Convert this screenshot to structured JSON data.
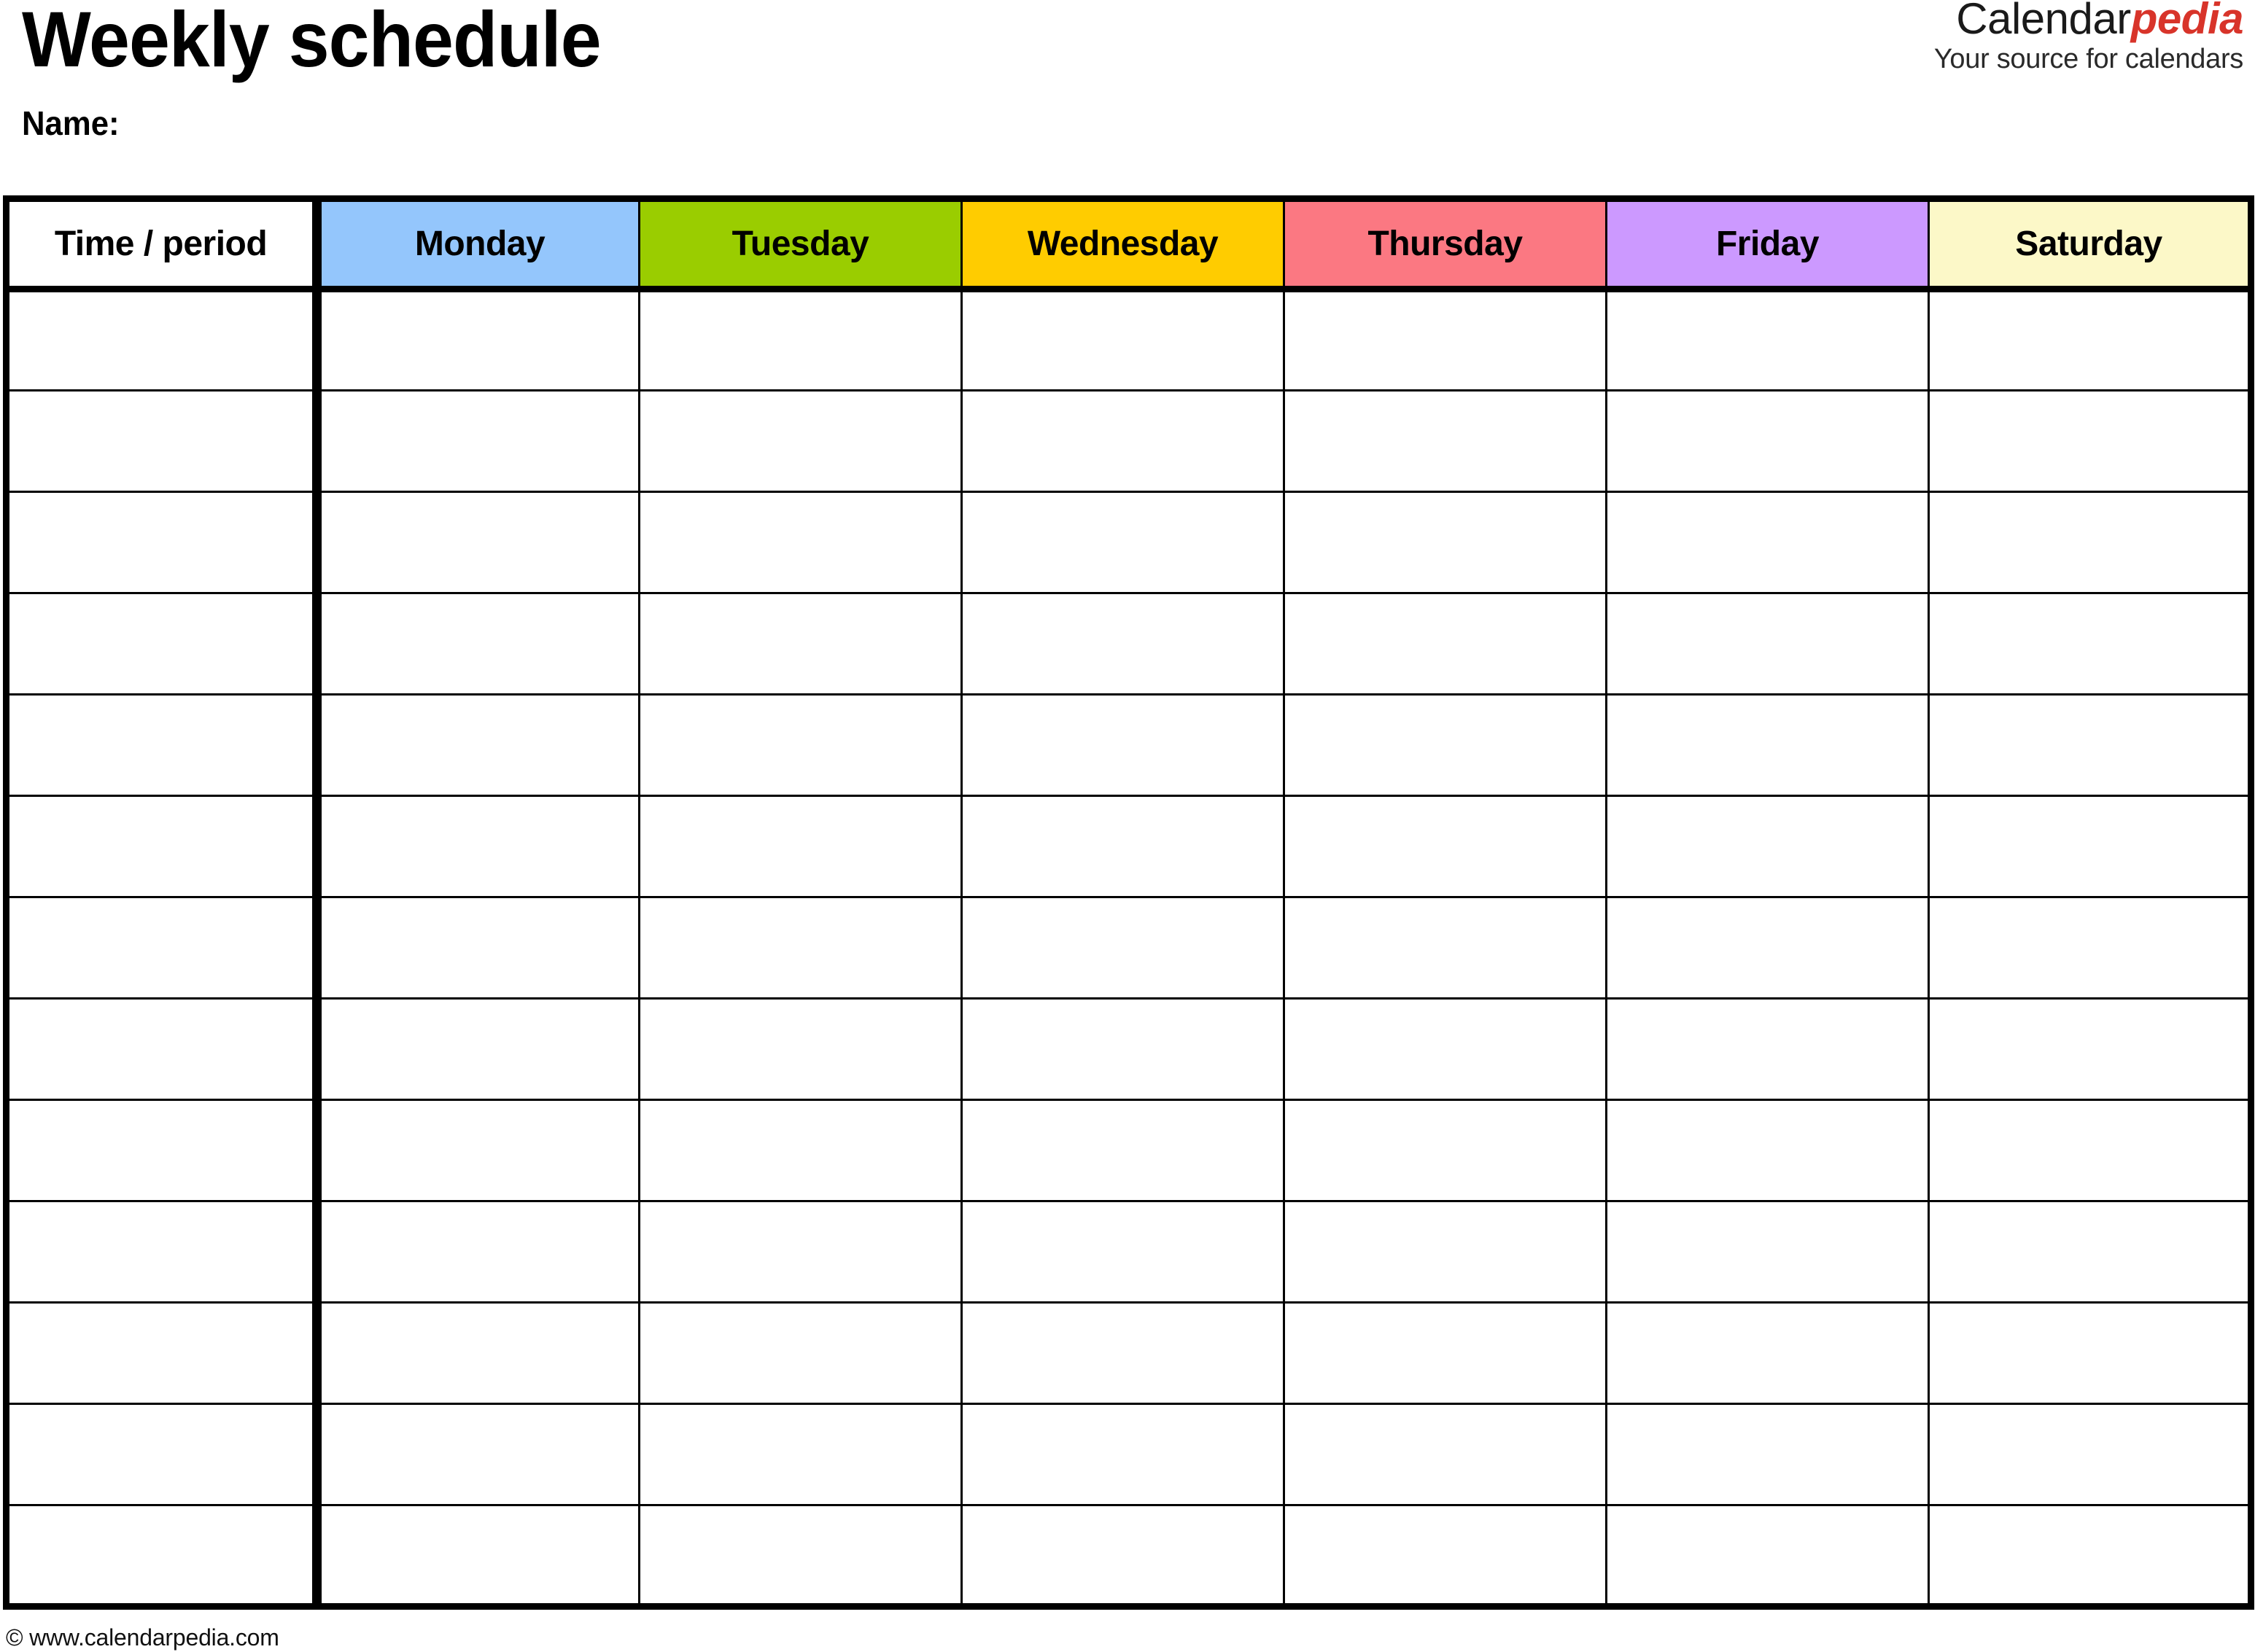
{
  "document": {
    "title": "Weekly schedule",
    "name_label": "Name:"
  },
  "logo": {
    "brand_primary": "Calendar",
    "brand_accent": "pedia",
    "tagline": "Your source for calendars",
    "accent_color": "#d8342a",
    "primary_color": "#1a1a1a"
  },
  "table": {
    "columns": [
      {
        "label": "Time / period",
        "bg": "#ffffff",
        "key": "time"
      },
      {
        "label": "Monday",
        "bg": "#94c6fc",
        "key": "monday"
      },
      {
        "label": "Tuesday",
        "bg": "#9acd00",
        "key": "tuesday"
      },
      {
        "label": "Wednesday",
        "bg": "#ffcc00",
        "key": "wednesday"
      },
      {
        "label": "Thursday",
        "bg": "#fb7882",
        "key": "thursday"
      },
      {
        "label": "Friday",
        "bg": "#cc99ff",
        "key": "friday"
      },
      {
        "label": "Saturday",
        "bg": "#fcf8c8",
        "key": "saturday"
      }
    ],
    "row_count": 13,
    "rows": [
      {
        "time": "",
        "monday": "",
        "tuesday": "",
        "wednesday": "",
        "thursday": "",
        "friday": "",
        "saturday": ""
      },
      {
        "time": "",
        "monday": "",
        "tuesday": "",
        "wednesday": "",
        "thursday": "",
        "friday": "",
        "saturday": ""
      },
      {
        "time": "",
        "monday": "",
        "tuesday": "",
        "wednesday": "",
        "thursday": "",
        "friday": "",
        "saturday": ""
      },
      {
        "time": "",
        "monday": "",
        "tuesday": "",
        "wednesday": "",
        "thursday": "",
        "friday": "",
        "saturday": ""
      },
      {
        "time": "",
        "monday": "",
        "tuesday": "",
        "wednesday": "",
        "thursday": "",
        "friday": "",
        "saturday": ""
      },
      {
        "time": "",
        "monday": "",
        "tuesday": "",
        "wednesday": "",
        "thursday": "",
        "friday": "",
        "saturday": ""
      },
      {
        "time": "",
        "monday": "",
        "tuesday": "",
        "wednesday": "",
        "thursday": "",
        "friday": "",
        "saturday": ""
      },
      {
        "time": "",
        "monday": "",
        "tuesday": "",
        "wednesday": "",
        "thursday": "",
        "friday": "",
        "saturday": ""
      },
      {
        "time": "",
        "monday": "",
        "tuesday": "",
        "wednesday": "",
        "thursday": "",
        "friday": "",
        "saturday": ""
      },
      {
        "time": "",
        "monday": "",
        "tuesday": "",
        "wednesday": "",
        "thursday": "",
        "friday": "",
        "saturday": ""
      },
      {
        "time": "",
        "monday": "",
        "tuesday": "",
        "wednesday": "",
        "thursday": "",
        "friday": "",
        "saturday": ""
      },
      {
        "time": "",
        "monday": "",
        "tuesday": "",
        "wednesday": "",
        "thursday": "",
        "friday": "",
        "saturday": ""
      },
      {
        "time": "",
        "monday": "",
        "tuesday": "",
        "wednesday": "",
        "thursday": "",
        "friday": "",
        "saturday": ""
      }
    ]
  },
  "footer": {
    "copyright": "© www.calendarpedia.com"
  }
}
